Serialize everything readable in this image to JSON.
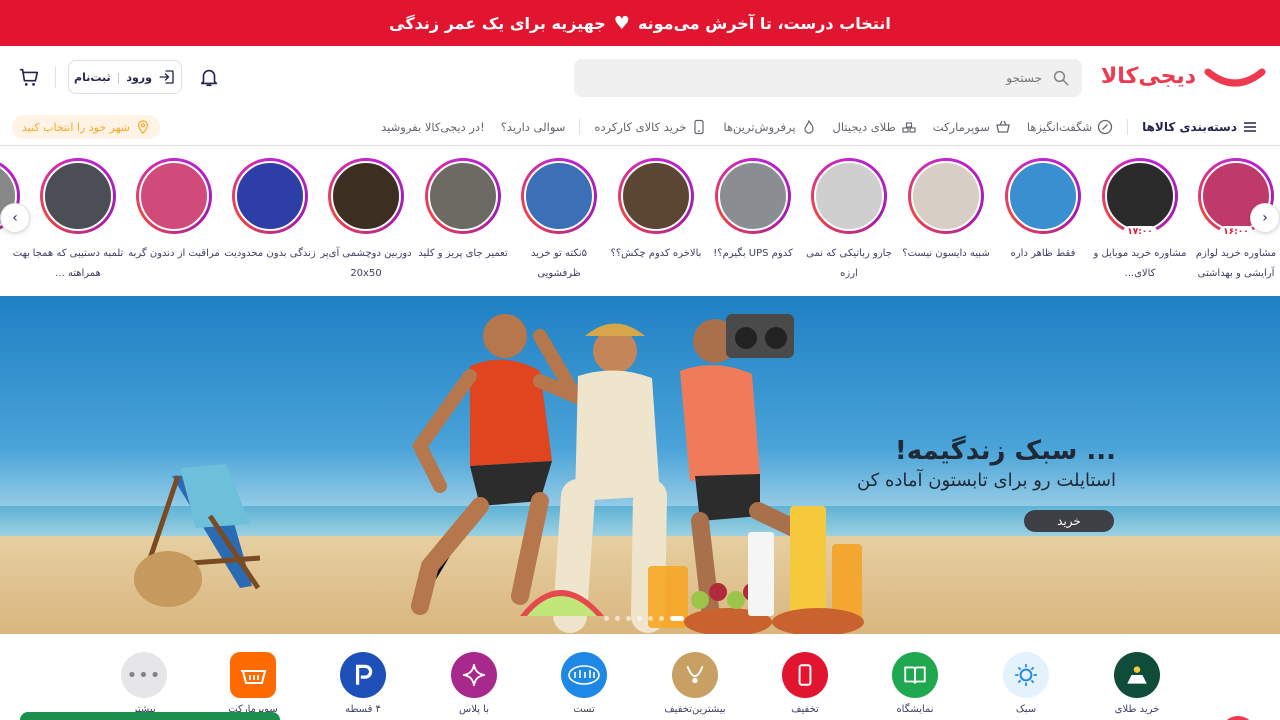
{
  "promo": {
    "text_before": "انتخاب درست، تا آخرش می‌مونه",
    "text_after": "جهیزیه برای یک عمر زندگی"
  },
  "header": {
    "logo_text": "دیجی‌کالا",
    "search_placeholder": "جستجو",
    "login_label": "ورود",
    "register_label": "ثبت‌نام",
    "login_separator": "|"
  },
  "nav": {
    "items": [
      {
        "label": "دسته‌بندی کالاها",
        "icon": "menu-icon"
      },
      {
        "label": "شگفت‌انگیزها",
        "icon": "percent-icon"
      },
      {
        "label": "سوپرمارکت",
        "icon": "basket-icon"
      },
      {
        "label": "طلای دیجیتال",
        "icon": "gold-bars-icon"
      },
      {
        "label": "پرفروش‌ترین‌ها",
        "icon": "fire-icon"
      },
      {
        "label": "خرید کالای کارکرده",
        "icon": "phone-icon"
      },
      {
        "label": "سوالی دارید؟",
        "icon": ""
      },
      {
        "label": "در دیجی‌کالا بفروشید!",
        "icon": ""
      }
    ],
    "city_label": "شهر خود را انتخاب کنید"
  },
  "stories": [
    {
      "caption": "مشاوره خرید لوازم آرایشی و بهداشتی",
      "time": "۱۶:۰۰",
      "color": "#c0396b"
    },
    {
      "caption": "مشاوره خرید موبایل و کالای...",
      "time": "۱۷:۰۰",
      "color": "#2b2b2b"
    },
    {
      "caption": "فقط ظاهر داره",
      "time": "",
      "color": "#3a8fd1"
    },
    {
      "caption": "شبیه دایسون نیست؟",
      "time": "",
      "color": "#d7cfc5"
    },
    {
      "caption": "جارو رباتیکی که نمی ارزه",
      "time": "",
      "color": "#cfcfcf"
    },
    {
      "caption": "کدوم UPS بگیرم؟!",
      "time": "",
      "color": "#8a8d92"
    },
    {
      "caption": "بالاخره کدوم چکش؟؟",
      "time": "",
      "color": "#5b4634"
    },
    {
      "caption": "۵نکته تو خرید ظرفشویی",
      "time": "",
      "color": "#3b6fb6"
    },
    {
      "caption": "تعمیر جای پریز و کلید",
      "time": "",
      "color": "#6c6a63"
    },
    {
      "caption": "دوربین دوچشمی آی‌پر 20x50",
      "time": "",
      "color": "#3d2e22"
    },
    {
      "caption": "زندگی بدون محدودیت",
      "time": "",
      "color": "#2d3fa6"
    },
    {
      "caption": "مراقبت از دندون گربه",
      "time": "",
      "color": "#d14b7a"
    },
    {
      "caption": "تلمبه دستیبی که همجا همراهته ...",
      "time": "",
      "color": "#4b4f55"
    },
    {
      "caption": "بهت",
      "time": "",
      "color": "#888"
    }
  ],
  "hero": {
    "title": "... سبک زندگیمه!",
    "subtitle": "استایلت رو برای تابستون آماده کن",
    "button": "خرید"
  },
  "quick_menu": [
    {
      "label": "خرید طلای",
      "color": "#0f4c3a",
      "icon": "gold-icon"
    },
    {
      "label": "سبک",
      "color": "#e3f2fd",
      "icon": "sun-icon"
    },
    {
      "label": "نمایشگاه",
      "color": "#1fa84f",
      "icon": "book-icon"
    },
    {
      "label": "تخفیف",
      "color": "#e1152f",
      "icon": "phone-icon"
    },
    {
      "label": "بیشترین‌تخفیف",
      "color": "#c8a064",
      "icon": "necklace-icon"
    },
    {
      "label": "تست",
      "color": "#1e88e5",
      "icon": "abidi-icon"
    },
    {
      "label": "با پلاس",
      "color": "#a8298c",
      "icon": "sparkle-icon"
    },
    {
      "label": "۴ قسطه",
      "color": "#1f4fb8",
      "icon": "p-icon"
    },
    {
      "label": "سوپرمارکت",
      "color": "#ff6a00",
      "icon": "basket-icon"
    },
    {
      "label": "بیشتر",
      "color": "#e6e6e8",
      "icon": "more-icon"
    }
  ]
}
